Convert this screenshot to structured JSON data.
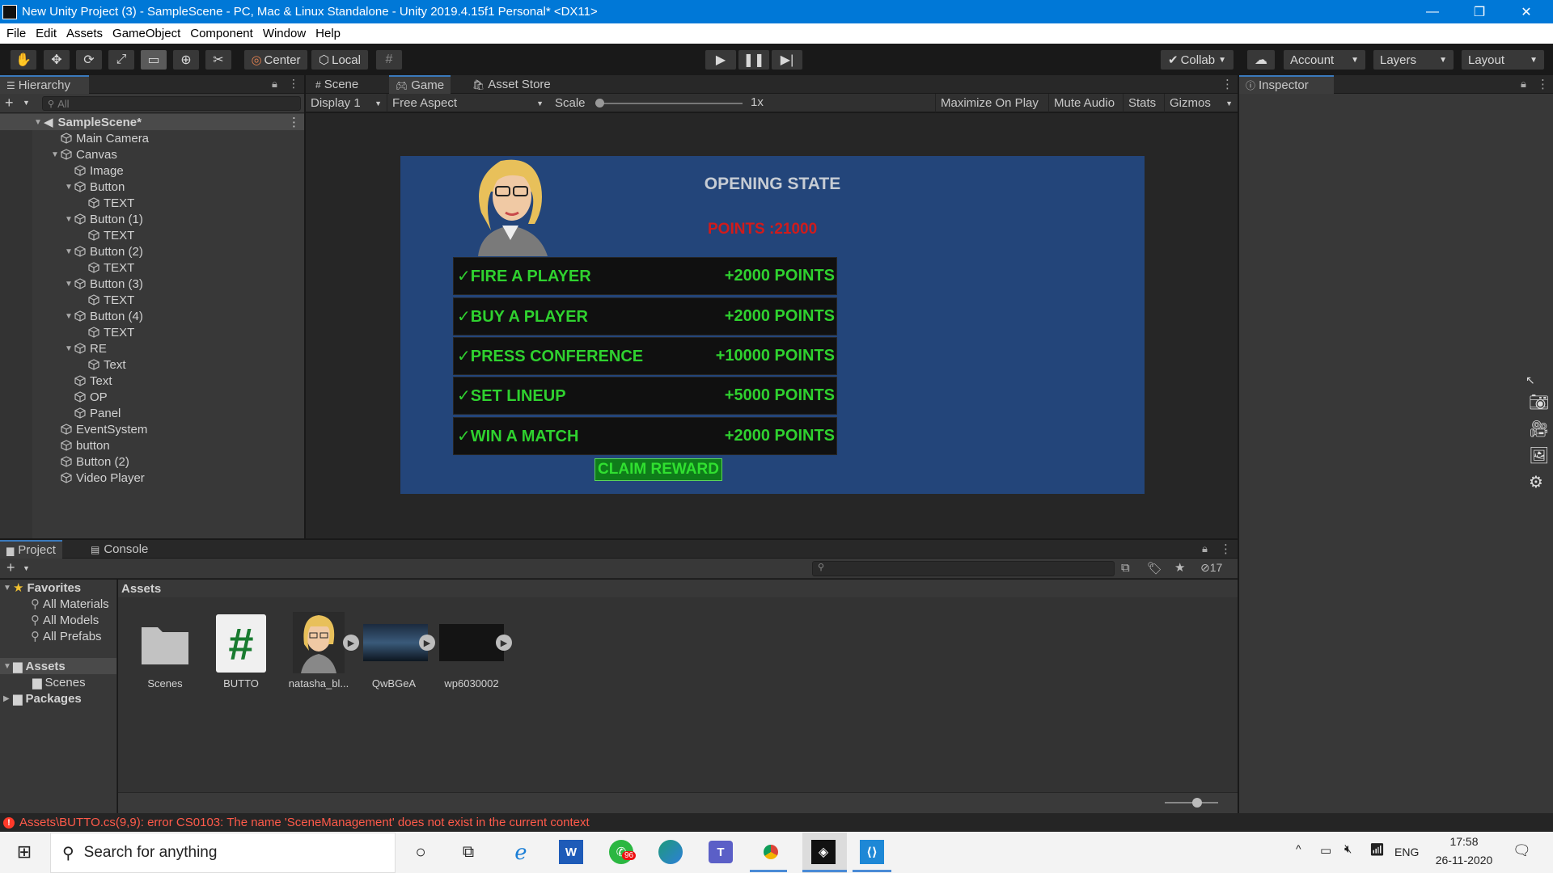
{
  "window": {
    "title": "New Unity Project (3) - SampleScene - PC, Mac & Linux Standalone - Unity 2019.4.15f1 Personal* <DX11>",
    "minimize": "—",
    "maximize": "❐",
    "close": "✕"
  },
  "menu": [
    "File",
    "Edit",
    "Assets",
    "GameObject",
    "Component",
    "Window",
    "Help"
  ],
  "toolbar": {
    "pivot": "Center",
    "space": "Local",
    "collab": "Collab",
    "account": "Account",
    "layers": "Layers",
    "layout": "Layout"
  },
  "hierarchy": {
    "title": "Hierarchy",
    "search_placeholder": "All",
    "scene": "SampleScene*",
    "items": [
      {
        "label": "Main Camera",
        "depth": 1,
        "expand": false
      },
      {
        "label": "Canvas",
        "depth": 1,
        "expand": true
      },
      {
        "label": "Image",
        "depth": 2,
        "expand": false
      },
      {
        "label": "Button",
        "depth": 2,
        "expand": true
      },
      {
        "label": "TEXT",
        "depth": 3,
        "expand": false
      },
      {
        "label": "Button (1)",
        "depth": 2,
        "expand": true
      },
      {
        "label": "TEXT",
        "depth": 3,
        "expand": false
      },
      {
        "label": "Button (2)",
        "depth": 2,
        "expand": true
      },
      {
        "label": "TEXT",
        "depth": 3,
        "expand": false
      },
      {
        "label": "Button (3)",
        "depth": 2,
        "expand": true
      },
      {
        "label": "TEXT",
        "depth": 3,
        "expand": false
      },
      {
        "label": "Button (4)",
        "depth": 2,
        "expand": true
      },
      {
        "label": "TEXT",
        "depth": 3,
        "expand": false
      },
      {
        "label": "RE",
        "depth": 2,
        "expand": true
      },
      {
        "label": "Text",
        "depth": 3,
        "expand": false
      },
      {
        "label": "Text",
        "depth": 2,
        "expand": false
      },
      {
        "label": "OP",
        "depth": 2,
        "expand": false
      },
      {
        "label": "Panel",
        "depth": 2,
        "expand": false
      },
      {
        "label": "EventSystem",
        "depth": 1,
        "expand": false
      },
      {
        "label": "button",
        "depth": 1,
        "expand": false
      },
      {
        "label": "Button (2)",
        "depth": 1,
        "expand": false
      },
      {
        "label": "Video Player",
        "depth": 1,
        "expand": false
      }
    ]
  },
  "viewtabs": {
    "scene": "Scene",
    "game": "Game",
    "store": "Asset Store"
  },
  "gamebar": {
    "display": "Display 1",
    "aspect": "Free Aspect",
    "scale_label": "Scale",
    "scale_value": "1x",
    "maximize": "Maximize On Play",
    "mute": "Mute Audio",
    "stats": "Stats",
    "gizmos": "Gizmos"
  },
  "game": {
    "heading": "OPENING STATE",
    "points": "POINTS :21000",
    "tasks": [
      {
        "name": "✓FIRE A PLAYER",
        "points": "+2000 POINTS"
      },
      {
        "name": "✓BUY A PLAYER",
        "points": "+2000 POINTS"
      },
      {
        "name": "✓PRESS CONFERENCE",
        "points": "+10000 POINTS"
      },
      {
        "name": "✓SET LINEUP",
        "points": "+5000 POINTS"
      },
      {
        "name": "✓WIN A MATCH",
        "points": "+2000 POINTS"
      }
    ],
    "claim": "CLAIM REWARD"
  },
  "inspector": {
    "title": "Inspector"
  },
  "project": {
    "tab_project": "Project",
    "tab_console": "Console",
    "hidden_count": "17",
    "breadcrumb": "Assets",
    "favorites": "Favorites",
    "fav_items": [
      "All Materials",
      "All Models",
      "All Prefabs"
    ],
    "assets": "Assets",
    "scenes": "Scenes",
    "packages": "Packages",
    "items": [
      {
        "label": "Scenes",
        "kind": "folder"
      },
      {
        "label": "BUTTO",
        "kind": "script"
      },
      {
        "label": "natasha_bl...",
        "kind": "character"
      },
      {
        "label": "QwBGeA",
        "kind": "video"
      },
      {
        "label": "wp6030002",
        "kind": "dark"
      }
    ]
  },
  "console_error": "Assets\\BUTTO.cs(9,9): error CS0103: The name 'SceneManagement' does not exist in the current context",
  "taskbar": {
    "search_placeholder": "Search for anything",
    "whatsapp_badge": "96",
    "language": "ENG",
    "time": "17:58",
    "date": "26-11-2020"
  },
  "colors": {
    "accent": "#3a79bb",
    "task_green": "#2fd12f",
    "points_red": "#d11b1b",
    "claim_bg": "#0f7d1a",
    "error": "#ff5a4a"
  }
}
